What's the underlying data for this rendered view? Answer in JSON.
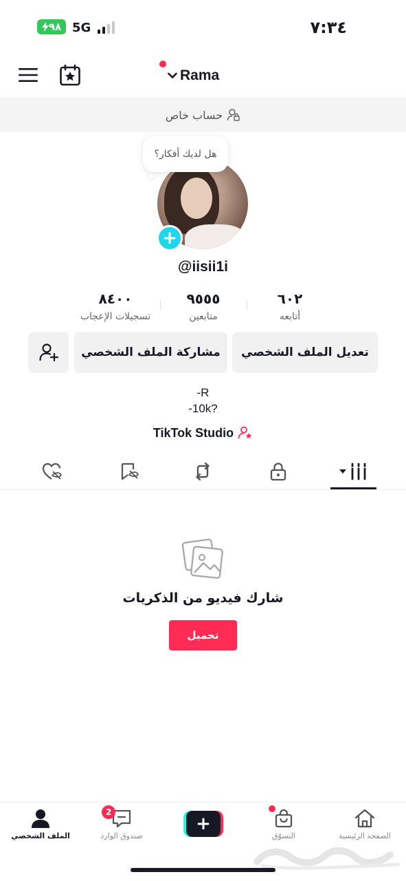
{
  "status_bar": {
    "battery": "٩٨",
    "network": "5G",
    "time": "٧:٣٤"
  },
  "header": {
    "username": "Rama",
    "menu_icon": "hamburger-icon",
    "calendar_icon": "calendar-star-icon"
  },
  "private_banner": {
    "label": "حساب خاص",
    "icon": "private-user-lock-icon"
  },
  "profile": {
    "thought_prompt": "هل لديك أفكار؟",
    "handle": "@iisii1i",
    "stats": {
      "likes": {
        "value": "٨٤٠٠",
        "label": "تسجيلات الإعجاب"
      },
      "followers": {
        "value": "٩٥٥٥",
        "label": "متابعين"
      },
      "following": {
        "value": "٦٠٢",
        "label": "أتابعه"
      }
    },
    "buttons": {
      "edit": "تعديل الملف الشخصي",
      "share": "مشاركة الملف الشخصي",
      "add_friend_icon": "add-friend-icon"
    },
    "bio_line1": "-R",
    "bio_line2": "-10k?",
    "studio_label": "TikTok Studio"
  },
  "tabs": [
    {
      "name": "videos",
      "icon": "grid-icon",
      "active": true
    },
    {
      "name": "private",
      "icon": "lock-icon",
      "active": false
    },
    {
      "name": "reposts",
      "icon": "repost-icon",
      "active": false
    },
    {
      "name": "favorites",
      "icon": "bookmark-hidden-icon",
      "active": false
    },
    {
      "name": "liked",
      "icon": "heart-hidden-icon",
      "active": false
    }
  ],
  "empty_state": {
    "title": "شارك فيديو من الذكريات",
    "upload_label": "تحميل",
    "icon": "photos-icon"
  },
  "bottom_nav": {
    "profile": "الملف الشخصي",
    "inbox": "صندوق الوارد",
    "inbox_badge": "2",
    "shop": "التسوّق",
    "home": "الصفحة الرئيسية"
  },
  "colors": {
    "accent": "#fe2c55",
    "cyan": "#20d5ec",
    "battery": "#34c759",
    "text": "#161823"
  }
}
